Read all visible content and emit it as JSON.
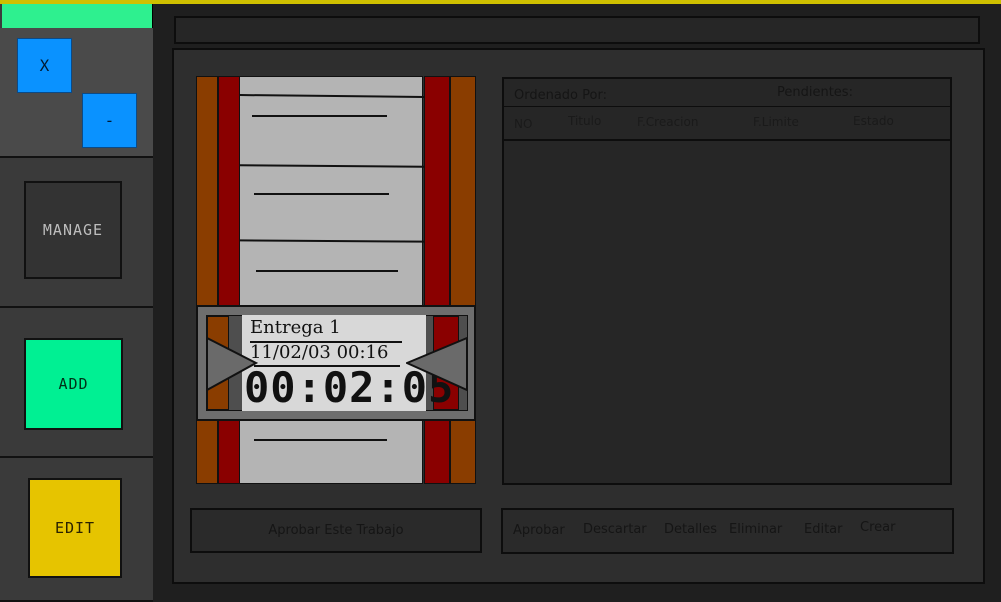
{
  "window": {
    "close_label": "X",
    "minimize_label": "-"
  },
  "nav": {
    "manage_label": "MANAGE",
    "add_label": "ADD",
    "edit_label": "EDIT"
  },
  "counter": {
    "title": "Entrega 1",
    "date": "11/02/03 00:16",
    "timer": "00:02:05"
  },
  "table": {
    "sorted_by_label": "Ordenado Por:",
    "pending_label": "Pendientes:",
    "columns": [
      "NO",
      "Titulo",
      "F.Creacion",
      "F.Limite",
      "Estado"
    ]
  },
  "approve_label": "Aprobar Este Trabajo",
  "actions": [
    "Aprobar",
    "Descartar",
    "Detalles",
    "Eliminar",
    "Editar",
    "Crear"
  ],
  "colors": {
    "top_bar": "#2ef08f",
    "window_buttons": "#0a92ff",
    "add_button": "#00f093",
    "edit_button": "#e6c400",
    "reel_wood": "#8a3d00",
    "reel_red": "#8a0000"
  }
}
